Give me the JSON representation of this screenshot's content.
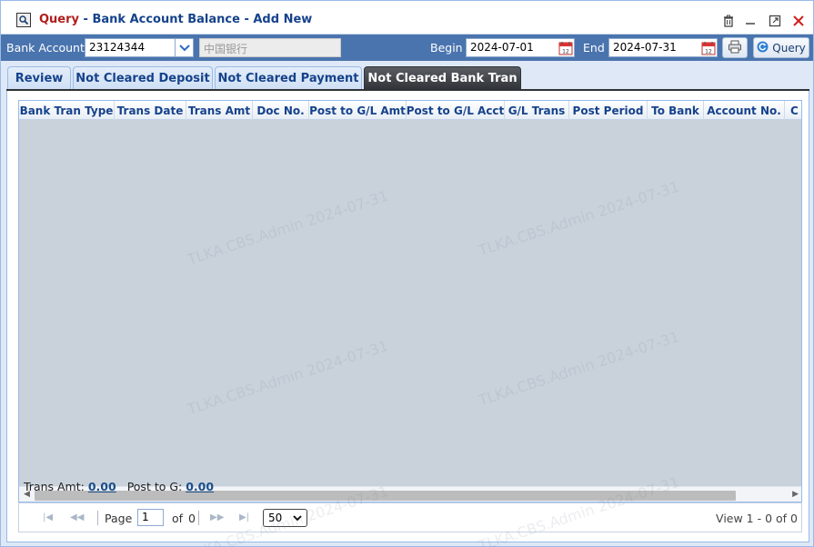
{
  "window": {
    "title_prefix": "Query",
    "title_sep": " - ",
    "title": "Bank Account Balance - Add New"
  },
  "toolbar": {
    "bank_account_label": "Bank Account",
    "bank_account_value": "23124344",
    "bank_name_value": "中国银行",
    "begin_label": "Begin",
    "begin_value": "2024-07-01",
    "end_label": "End",
    "end_value": "2024-07-31",
    "query_label": "Query"
  },
  "tabs": [
    {
      "label": "Review"
    },
    {
      "label": "Not Cleared Deposit"
    },
    {
      "label": "Not Cleared Payment"
    },
    {
      "label": "Not Cleared Bank Tran"
    }
  ],
  "grid": {
    "columns": [
      {
        "label": "Bank Tran Type"
      },
      {
        "label": "Trans Date"
      },
      {
        "label": "Trans Amt"
      },
      {
        "label": "Doc No."
      },
      {
        "label": "Post to G/L Amt"
      },
      {
        "label": "Post to G/L Acct"
      },
      {
        "label": "G/L Trans"
      },
      {
        "label": "Post Period"
      },
      {
        "label": "To Bank"
      },
      {
        "label": "Account No."
      },
      {
        "label": "C"
      }
    ],
    "rows": []
  },
  "summary": {
    "trans_amt_label": "Trans Amt:",
    "trans_amt_value": "0.00",
    "post_to_g_label": "Post to G:",
    "post_to_g_value": "0.00"
  },
  "pager": {
    "page_label": "Page",
    "page_value": "1",
    "of_label": "of",
    "total_pages": "0",
    "page_size": "50",
    "view_text": "View 1 - 0 of 0"
  },
  "watermark": "TLKA.CBS.Admin 2024-07-31",
  "colors": {
    "accent": "#4a74ae",
    "title_prefix": "#b01d1d",
    "tab_active": "#2f3236",
    "grid_body": "#c9d2db"
  },
  "icons": [
    "window-icon",
    "delete-icon",
    "minimize-icon",
    "maximize-icon",
    "close-icon",
    "chevron-down-icon",
    "calendar-icon",
    "print-icon",
    "refresh-icon"
  ]
}
